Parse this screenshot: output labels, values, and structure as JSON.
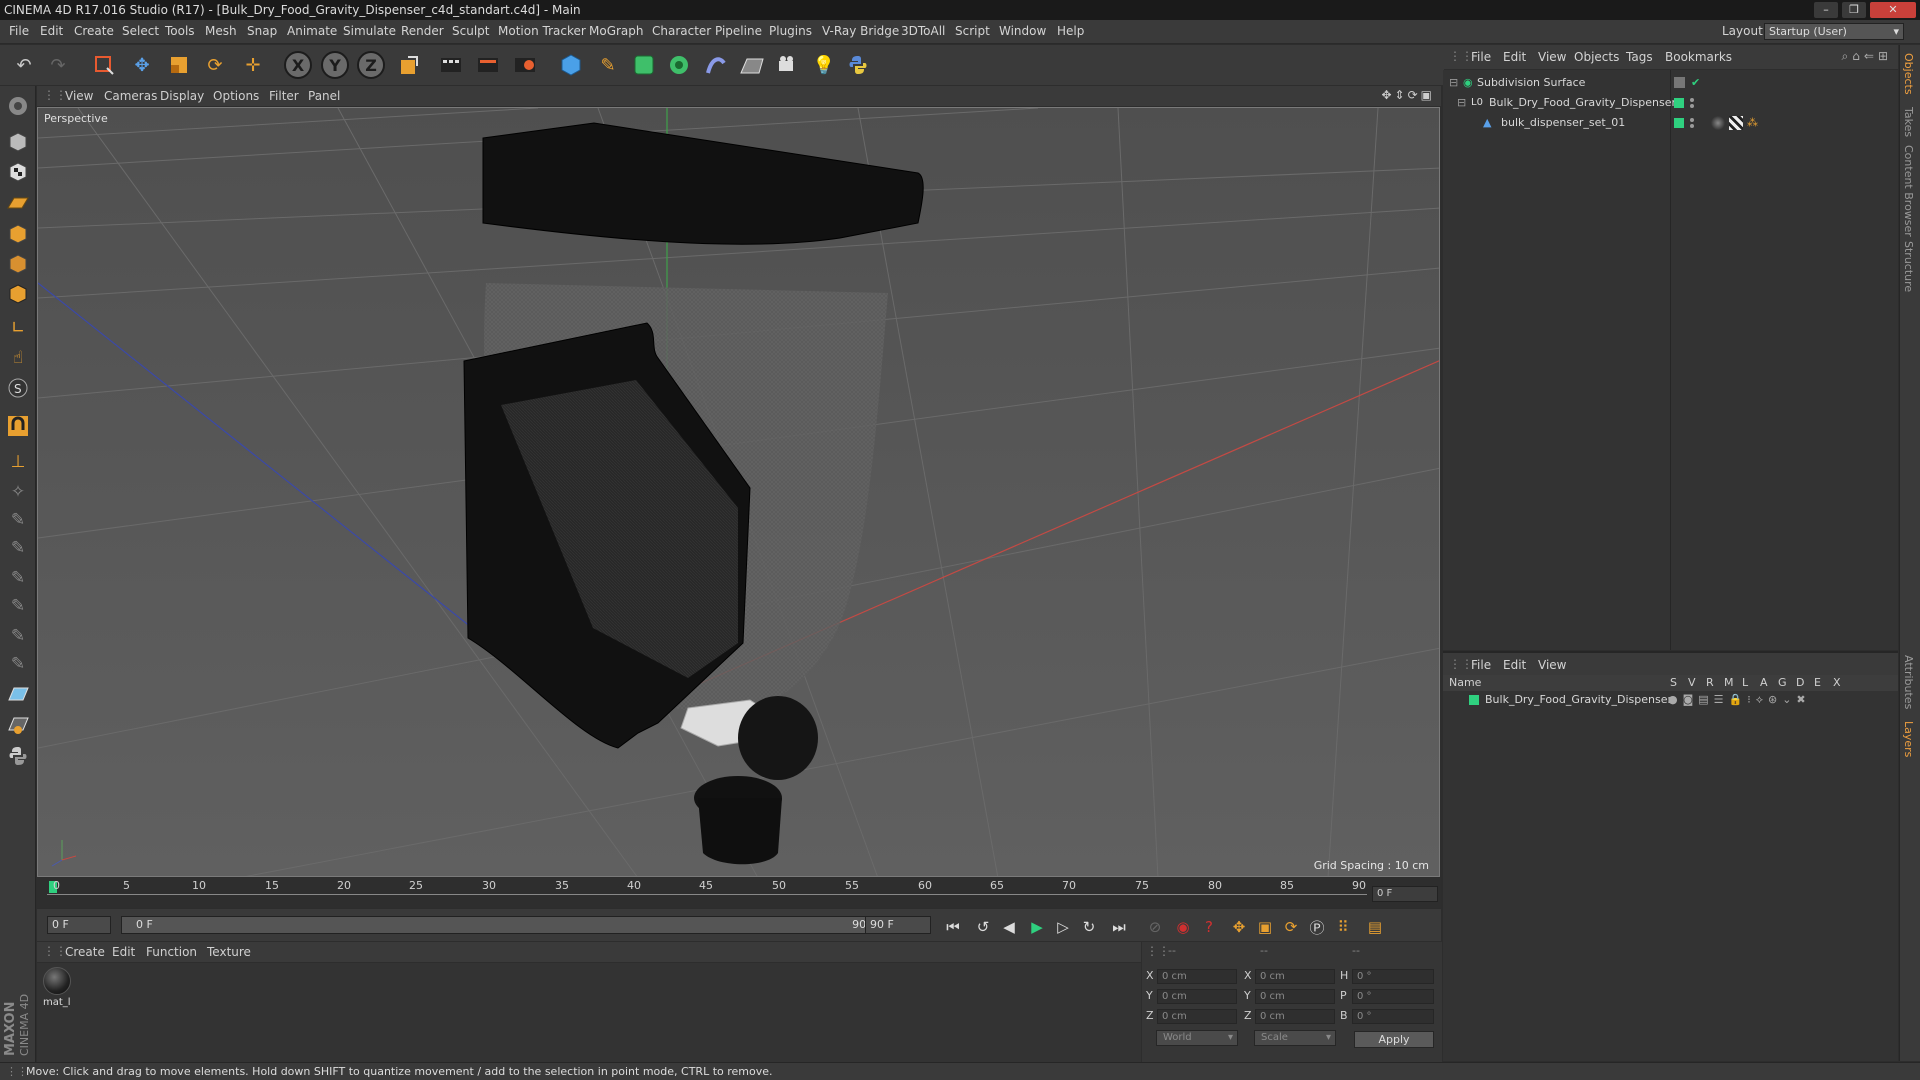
{
  "window": {
    "title": "CINEMA 4D R17.016 Studio (R17) - [Bulk_Dry_Food_Gravity_Dispenser_c4d_standart.c4d] - Main"
  },
  "menubar": {
    "items": [
      "File",
      "Edit",
      "Create",
      "Select",
      "Tools",
      "Mesh",
      "Snap",
      "Animate",
      "Simulate",
      "Render",
      "Sculpt",
      "Motion Tracker",
      "MoGraph",
      "Character",
      "Pipeline",
      "Plugins",
      "V-Ray Bridge",
      "3DToAll",
      "Script",
      "Window",
      "Help"
    ],
    "layout_label": "Layout:",
    "layout_value": "Startup (User)"
  },
  "toolbar": {
    "axis_x": "X",
    "axis_y": "Y",
    "axis_z": "Z"
  },
  "viewport": {
    "menu": [
      "View",
      "Cameras",
      "Display",
      "Options",
      "Filter",
      "Panel"
    ],
    "label": "Perspective",
    "grid_spacing": "Grid Spacing : 10 cm"
  },
  "timeline": {
    "ticks": [
      "0",
      "5",
      "10",
      "15",
      "20",
      "25",
      "30",
      "35",
      "40",
      "45",
      "50",
      "55",
      "60",
      "65",
      "70",
      "75",
      "80",
      "85",
      "90"
    ],
    "current_frame": "0 F"
  },
  "transport": {
    "start_field": "0 F",
    "range_start": "0 F",
    "range_end": "90 F",
    "end_field": "90 F"
  },
  "material_manager": {
    "menu": [
      "Create",
      "Edit",
      "Function",
      "Texture"
    ],
    "material_name": "mat_l"
  },
  "coordinates": {
    "header_dashes": [
      "--",
      "--",
      "--"
    ],
    "rows": [
      {
        "l1": "X",
        "v1": "0 cm",
        "l2": "X",
        "v2": "0 cm",
        "l3": "H",
        "v3": "0 °"
      },
      {
        "l1": "Y",
        "v1": "0 cm",
        "l2": "Y",
        "v2": "0 cm",
        "l3": "P",
        "v3": "0 °"
      },
      {
        "l1": "Z",
        "v1": "0 cm",
        "l2": "Z",
        "v2": "0 cm",
        "l3": "B",
        "v3": "0 °"
      }
    ],
    "space": "World",
    "mode": "Scale",
    "apply": "Apply"
  },
  "object_manager": {
    "menu": [
      "File",
      "Edit",
      "View",
      "Objects",
      "Tags",
      "Bookmarks"
    ],
    "objects": [
      {
        "name": "Subdivision Surface",
        "indent": 0
      },
      {
        "name": "Bulk_Dry_Food_Gravity_Dispenser",
        "indent": 1
      },
      {
        "name": "bulk_dispenser_set_01",
        "indent": 2
      }
    ]
  },
  "layer_manager": {
    "menu": [
      "File",
      "Edit",
      "View"
    ],
    "columns": [
      "Name",
      "S",
      "V",
      "R",
      "M",
      "L",
      "A",
      "G",
      "D",
      "E",
      "X"
    ],
    "layers": [
      {
        "name": "Bulk_Dry_Food_Gravity_Dispenser"
      }
    ]
  },
  "right_tabs": [
    "Objects",
    "Takes",
    "Content Browser",
    "Structure",
    "Attributes",
    "Layers"
  ],
  "statusbar": {
    "text": "Move: Click and drag to move elements. Hold down SHIFT to quantize movement / add to the selection in point mode, CTRL to remove."
  },
  "logo": {
    "text1": "MAXON",
    "text2": "CINEMA 4D"
  },
  "colors": {
    "accent_green": "#2fd07f",
    "axis_red": "#c44a44",
    "axis_blue": "#3b49a8",
    "axis_green": "#3fa04a"
  }
}
